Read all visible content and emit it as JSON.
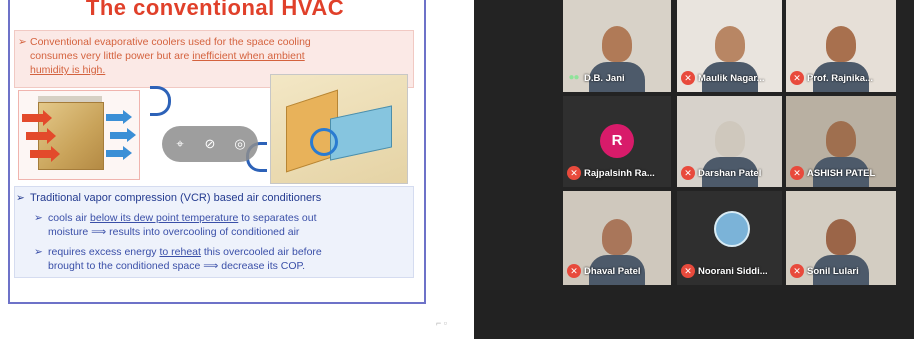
{
  "slide": {
    "title": "The conventional HVAC",
    "intro_line1": "Conventional evaporative coolers used for the space cooling",
    "intro_line2": "consumes very little power but are",
    "intro_underline": "inefficient when ambient",
    "intro_line3": "humidity is high.",
    "bullet_vcr": "Traditional vapor compression (VCR) based air conditioners",
    "sub1_line1_prefix": "cools air",
    "sub1_underline": "below its dew point temperature",
    "sub1_line1_suffix": "to separates out",
    "sub1_line2": "moisture ⟹ results into overcooling of conditioned air",
    "sub2_line1_prefix": "requires excess energy",
    "sub2_underline": "to reheat",
    "sub2_line1_suffix": "this overcooled air before",
    "sub2_line2": "brought to the conditioned space ⟹ decrease its COP.",
    "page_mark": "⌐ ▫"
  },
  "meeting": {
    "participants": [
      {
        "name": "D.B. Jani",
        "muted": false,
        "skin": "#b07a57",
        "bg": "#d8d2c8"
      },
      {
        "name": "Maulik Nagar...",
        "muted": true,
        "skin": "#b88664",
        "bg": "#e9e4de"
      },
      {
        "name": "Prof. Rajnika...",
        "muted": true,
        "skin": "#a8704e",
        "bg": "#e6dfd7"
      },
      {
        "name": "Rajpalsinh Ra...",
        "muted": true,
        "avatar_letter": "R",
        "avatar_color": "#d81b6a",
        "bg": "#2f2f2f"
      },
      {
        "name": "Darshan Patel",
        "muted": true,
        "skin": "#cfc8bd",
        "bg": "#d7d2cb"
      },
      {
        "name": "ASHISH PATEL",
        "muted": true,
        "skin": "#9f6f4f",
        "bg": "#b9b0a2"
      },
      {
        "name": "Dhaval Patel",
        "muted": true,
        "skin": "#a9765a",
        "bg": "#cfc8bd"
      },
      {
        "name": "Noorani Siddi...",
        "muted": true,
        "avatar_letter": "",
        "avatar_color": "#7bb3d8",
        "bg": "#2f2f2f"
      },
      {
        "name": "Sonil Lulari",
        "muted": true,
        "skin": "#9b6548",
        "bg": "#d3cdc2"
      }
    ]
  }
}
